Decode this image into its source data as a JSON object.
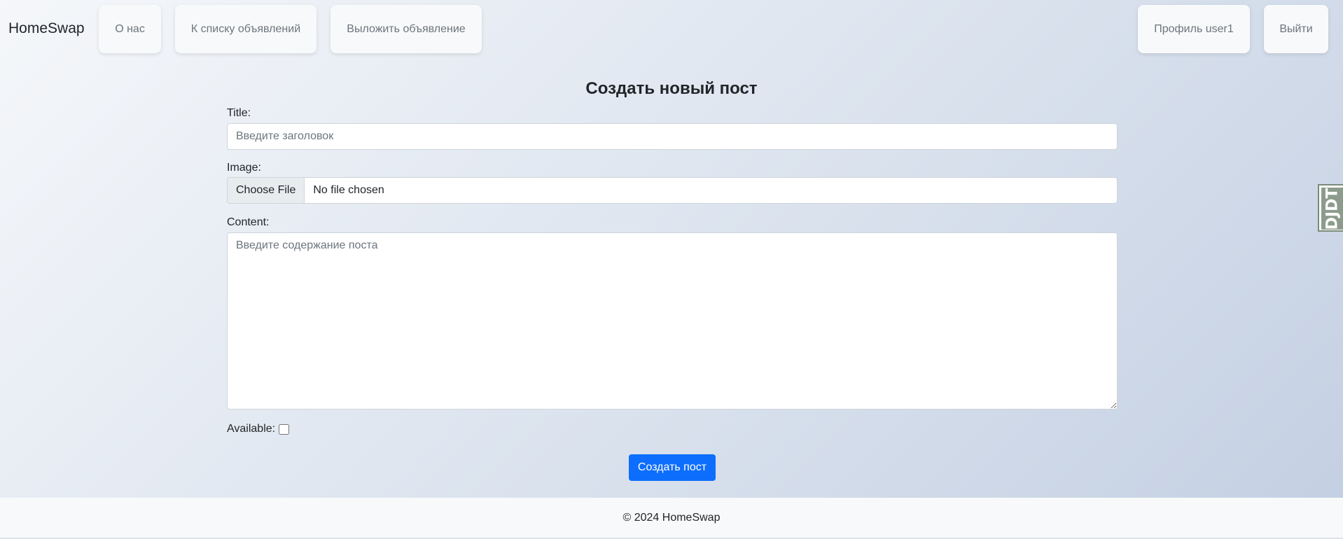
{
  "nav": {
    "brand": "HomeSwap",
    "about": "О нас",
    "list": "К списку объявлений",
    "post": "Выложить объявление",
    "profile": "Профиль user1",
    "logout": "Выйти"
  },
  "page": {
    "title": "Создать новый пост"
  },
  "form": {
    "title_label": "Title:",
    "title_placeholder": "Введите заголовок",
    "image_label": "Image:",
    "choose_file": "Choose File",
    "file_status": "No file chosen",
    "content_label": "Content:",
    "content_placeholder": "Введите содержание поста",
    "available_label": "Available:",
    "available_checked": false,
    "submit": "Создать пост"
  },
  "footer": {
    "text": "© 2024 HomeSwap"
  },
  "debug_toolbar": {
    "label": "DJDT"
  },
  "colors": {
    "primary": "#0d6efd",
    "footer_bg": "#f8f9fa"
  }
}
